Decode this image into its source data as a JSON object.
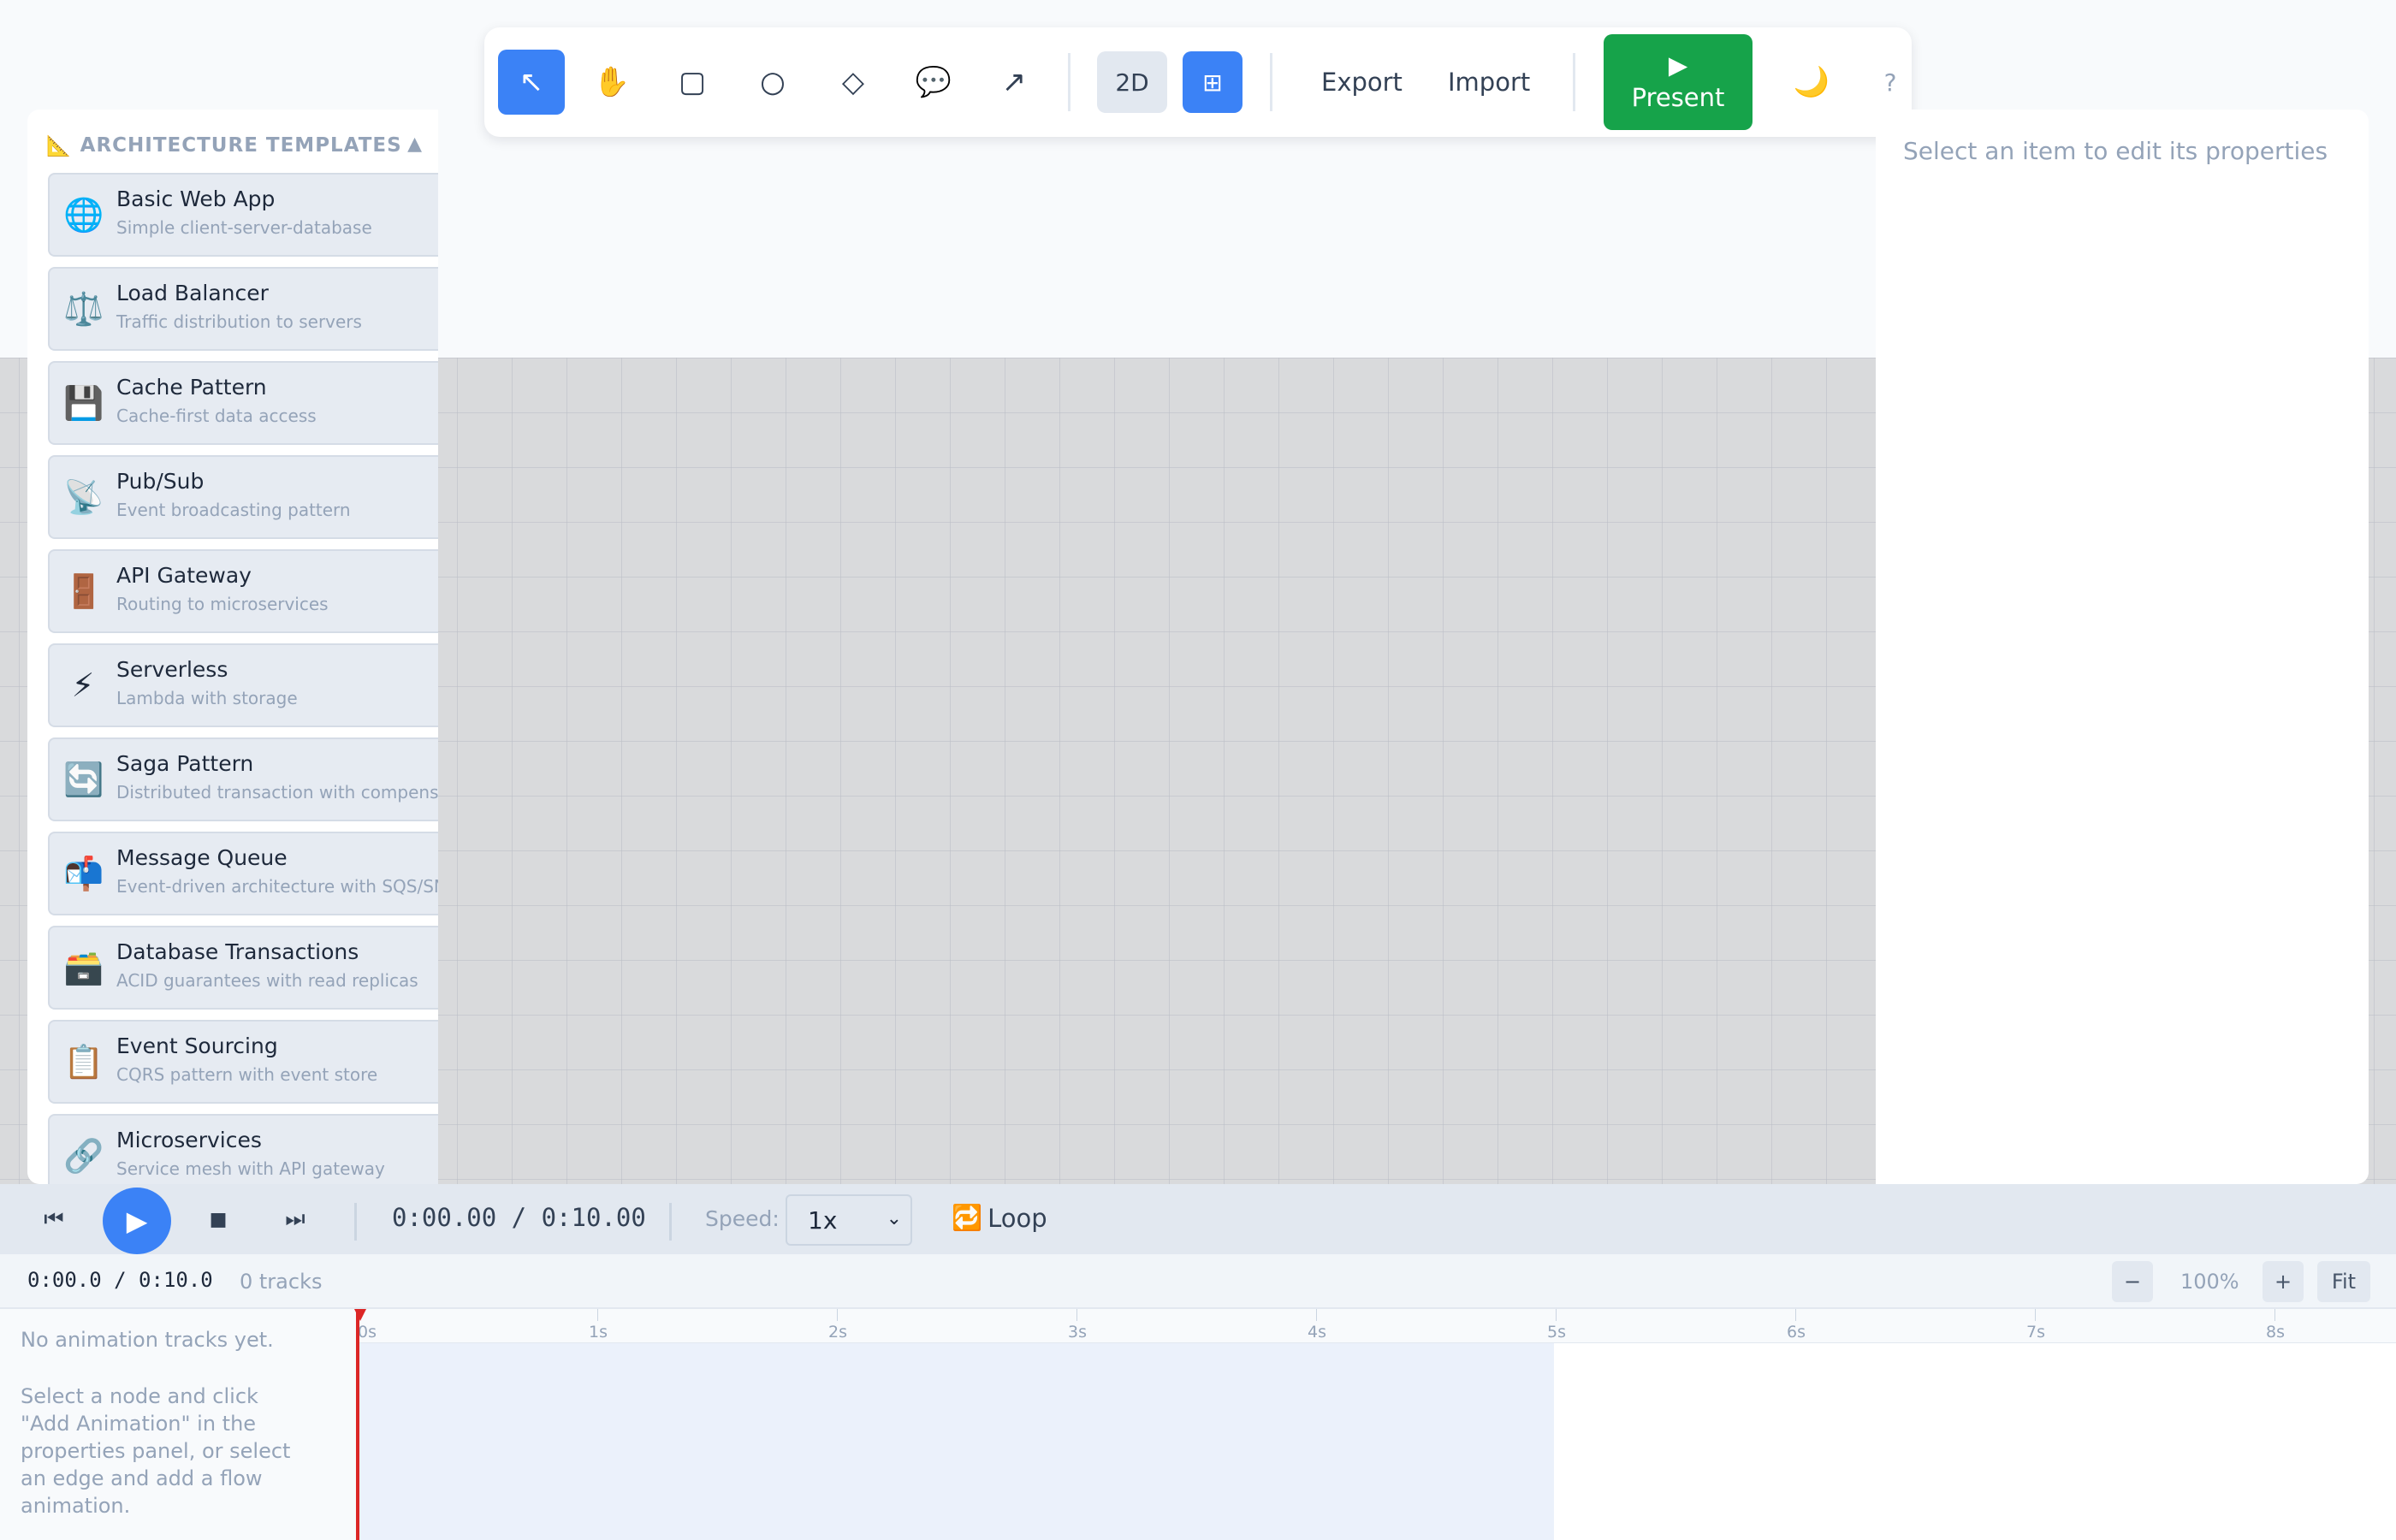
{
  "toolbar": {
    "tools": [
      {
        "name": "select",
        "glyph": "↖"
      },
      {
        "name": "pan",
        "glyph": "✋"
      },
      {
        "name": "rectangle",
        "glyph": "▢"
      },
      {
        "name": "circle",
        "glyph": "○"
      },
      {
        "name": "diamond",
        "glyph": "◇"
      },
      {
        "name": "comment",
        "glyph": "💬"
      },
      {
        "name": "arrow",
        "glyph": "↗"
      }
    ],
    "view_2d": "2D",
    "grid_glyph": "⊞",
    "export_label": "Export",
    "import_label": "Import",
    "present_icon": "▶",
    "present_label": "Present",
    "theme_glyph": "🌙",
    "help_label": "?"
  },
  "sidebar": {
    "icon": "📐",
    "title": "ARCHITECTURE TEMPLATES",
    "collapse_glyph": "▲",
    "templates": [
      {
        "icon": "🌐",
        "title": "Basic Web App",
        "desc": "Simple client-server-database"
      },
      {
        "icon": "⚖️",
        "title": "Load Balancer",
        "desc": "Traffic distribution to servers"
      },
      {
        "icon": "💾",
        "title": "Cache Pattern",
        "desc": "Cache-first data access"
      },
      {
        "icon": "📡",
        "title": "Pub/Sub",
        "desc": "Event broadcasting pattern"
      },
      {
        "icon": "🚪",
        "title": "API Gateway",
        "desc": "Routing to microservices"
      },
      {
        "icon": "⚡",
        "title": "Serverless",
        "desc": "Lambda with storage"
      },
      {
        "icon": "🔄",
        "title": "Saga Pattern",
        "desc": "Distributed transaction with compensation"
      },
      {
        "icon": "📬",
        "title": "Message Queue",
        "desc": "Event-driven architecture with SQS/SNS"
      },
      {
        "icon": "🗃️",
        "title": "Database Transactions",
        "desc": "ACID guarantees with read replicas"
      },
      {
        "icon": "📋",
        "title": "Event Sourcing",
        "desc": "CQRS pattern with event store"
      },
      {
        "icon": "🔗",
        "title": "Microservices",
        "desc": "Service mesh with API gateway"
      }
    ]
  },
  "properties": {
    "empty_message": "Select an item to edit its properties"
  },
  "player": {
    "skip_back_glyph": "⏮",
    "play_glyph": "▶",
    "stop_glyph": "■",
    "skip_forward_glyph": "⏭",
    "time": "0:00.00 / 0:10.00",
    "speed_label": "Speed:",
    "speed_value": "1x",
    "speed_arrow": "⌄",
    "loop_icon": "🔁",
    "loop_label": "Loop"
  },
  "timeline": {
    "time": "0:00.0 / 0:10.0",
    "tracks": "0 tracks",
    "zoom_out": "−",
    "zoom_value": "100%",
    "zoom_in": "+",
    "fit": "Fit",
    "empty_title": "No animation tracks yet.",
    "empty_desc": "Select a node and click \"Add Animation\" in the properties panel, or select an edge and add a flow animation.",
    "ruler_labels": [
      "0s",
      "1s",
      "2s",
      "3s",
      "4s",
      "5s",
      "6s",
      "7s",
      "8s"
    ]
  },
  "colors": {
    "accent": "#3b82f6",
    "present": "#16a34a",
    "playhead": "#dc2626"
  }
}
